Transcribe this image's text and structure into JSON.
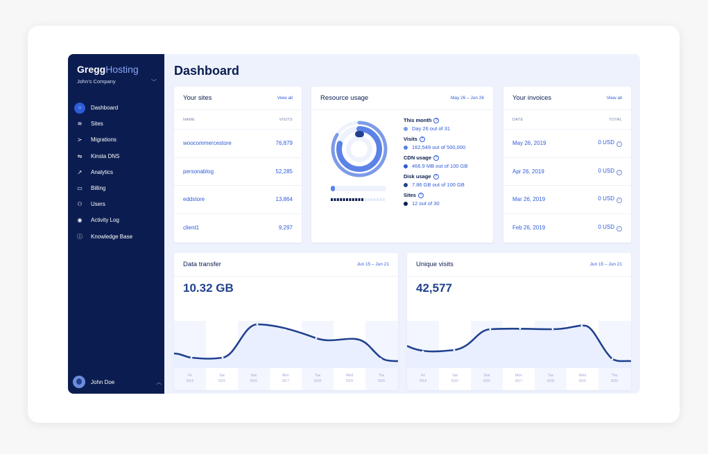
{
  "brand": {
    "part1": "Gregg",
    "part2": "Hosting"
  },
  "company": "John's Company",
  "nav": [
    {
      "label": "Dashboard",
      "icon": "home-icon",
      "glyph": "⌂",
      "active": true
    },
    {
      "label": "Sites",
      "icon": "layers-icon",
      "glyph": "≋",
      "active": false
    },
    {
      "label": "Migrations",
      "icon": "migrate-icon",
      "glyph": "≻",
      "active": false
    },
    {
      "label": "Kinsta DNS",
      "icon": "dns-icon",
      "glyph": "⇋",
      "active": false
    },
    {
      "label": "Analytics",
      "icon": "trend-icon",
      "glyph": "↗",
      "active": false
    },
    {
      "label": "Billing",
      "icon": "billing-icon",
      "glyph": "▭",
      "active": false
    },
    {
      "label": "Users",
      "icon": "users-icon",
      "glyph": "⚇",
      "active": false
    },
    {
      "label": "Activity Log",
      "icon": "eye-icon",
      "glyph": "◉",
      "active": false
    },
    {
      "label": "Knowledge Base",
      "icon": "help-icon",
      "glyph": "ⓘ",
      "active": false
    }
  ],
  "user": {
    "name": "John Doe"
  },
  "page_title": "Dashboard",
  "sites": {
    "title": "Your sites",
    "link": "View all",
    "col_name": "NAME",
    "col_visits": "VISITS",
    "rows": [
      {
        "name": "woocommercestore",
        "visits": "76,879"
      },
      {
        "name": "personablog",
        "visits": "52,285"
      },
      {
        "name": "eddstore",
        "visits": "13,864"
      },
      {
        "name": "client1",
        "visits": "9,297"
      }
    ]
  },
  "resource": {
    "title": "Resource usage",
    "range": "May 26 – Jun 26",
    "stats": [
      {
        "label": "This month",
        "value": "Day 26 out of 31",
        "color": "#7d9be8",
        "fraction": 0.84
      },
      {
        "label": "Visits",
        "value": "162,549 out of 500,000",
        "color": "#5b82e6",
        "fraction": 0.33
      },
      {
        "label": "CDN usage",
        "value": "466.9 MB out of 100 GB",
        "color": "#2e5bd8",
        "fraction": 0.005
      },
      {
        "label": "Disk usage",
        "value": "7.86 GB out of 100 GB",
        "color": "#21418e",
        "fraction": 0.08
      },
      {
        "label": "Sites",
        "value": "12 out of 30",
        "color": "#0b1d50",
        "fraction": 0.4
      }
    ]
  },
  "invoices": {
    "title": "Your invoices",
    "link": "View all",
    "col_date": "DATE",
    "col_total": "TOTAL",
    "rows": [
      {
        "date": "May 26, 2019",
        "total": "0 USD"
      },
      {
        "date": "Apr 26, 2019",
        "total": "0 USD"
      },
      {
        "date": "Mar 26, 2019",
        "total": "0 USD"
      },
      {
        "date": "Feb 26, 2019",
        "total": "0 USD"
      }
    ]
  },
  "transfer": {
    "title": "Data transfer",
    "range": "Jun 15 – Jun 21",
    "value": "10.32 GB",
    "days": [
      {
        "day": "Fri",
        "date": "6/14"
      },
      {
        "day": "Sat",
        "date": "6/15"
      },
      {
        "day": "Sun",
        "date": "6/16"
      },
      {
        "day": "Mon",
        "date": "6/17"
      },
      {
        "day": "Tue",
        "date": "6/18"
      },
      {
        "day": "Wed",
        "date": "6/19"
      },
      {
        "day": "Thu",
        "date": "6/20"
      }
    ]
  },
  "visits": {
    "title": "Unique visits",
    "range": "Jun 15 – Jun 21",
    "value": "42,577",
    "days": [
      {
        "day": "Fri",
        "date": "6/14"
      },
      {
        "day": "Sat",
        "date": "6/15"
      },
      {
        "day": "Sun",
        "date": "6/16"
      },
      {
        "day": "Mon",
        "date": "6/17"
      },
      {
        "day": "Tue",
        "date": "6/18"
      },
      {
        "day": "Wed",
        "date": "6/19"
      },
      {
        "day": "Thu",
        "date": "6/20"
      }
    ]
  },
  "colors": {
    "sidebar": "#0b1d50",
    "accent": "#2e5bd8",
    "line": "#21418e",
    "background": "#eef2fd"
  }
}
